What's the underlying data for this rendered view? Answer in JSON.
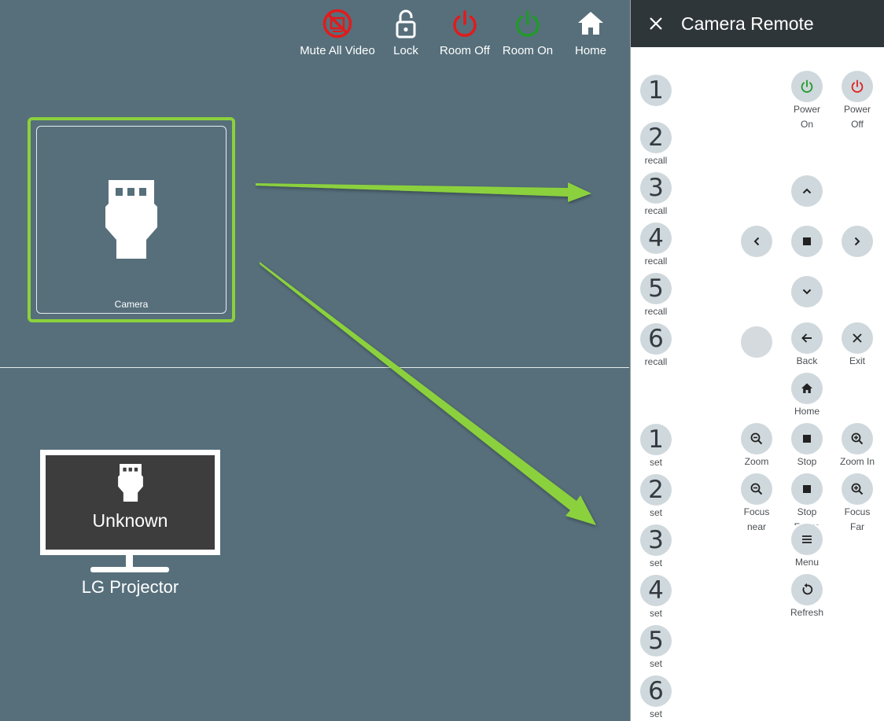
{
  "toolbar": {
    "mute_all_video": "Mute All Video",
    "lock": "Lock",
    "room_off": "Room Off",
    "room_on": "Room On",
    "home": "Home"
  },
  "source": {
    "label": "Camera",
    "icon": "hdmi-plug-icon",
    "selected": true
  },
  "display": {
    "status": "Unknown",
    "name": "LG Projector",
    "icon": "hdmi-plug-icon"
  },
  "panel": {
    "title": "Camera Remote",
    "presets_recall": [
      {
        "number": "1",
        "label": ""
      },
      {
        "number": "2",
        "label": "recall"
      },
      {
        "number": "3",
        "label": "recall"
      },
      {
        "number": "4",
        "label": "recall"
      },
      {
        "number": "5",
        "label": "recall"
      },
      {
        "number": "6",
        "label": "recall"
      }
    ],
    "presets_set": [
      {
        "number": "1",
        "label": "set"
      },
      {
        "number": "2",
        "label": "set"
      },
      {
        "number": "3",
        "label": "set"
      },
      {
        "number": "4",
        "label": "set"
      },
      {
        "number": "5",
        "label": "set"
      },
      {
        "number": "6",
        "label": "set"
      }
    ],
    "power_on": "Power\nOn",
    "power_off": "Power\nOff",
    "back": "Back",
    "exit": "Exit",
    "home": "Home",
    "zoom_out": "Zoom\nOut",
    "stop_zoom": "Stop",
    "zoom_in": "Zoom In",
    "focus_near": "Focus\nnear",
    "stop_focus": "Stop\nFocus",
    "focus_far": "Focus\nFar",
    "menu": "Menu",
    "refresh": "Refresh"
  },
  "colors": {
    "background": "#566f7b",
    "accent_green": "#8bd13c",
    "power_off_red": "#e02020",
    "power_on_green": "#1f9a2a",
    "panel_header": "#2f363a",
    "button_grey": "#cfd8dc"
  }
}
